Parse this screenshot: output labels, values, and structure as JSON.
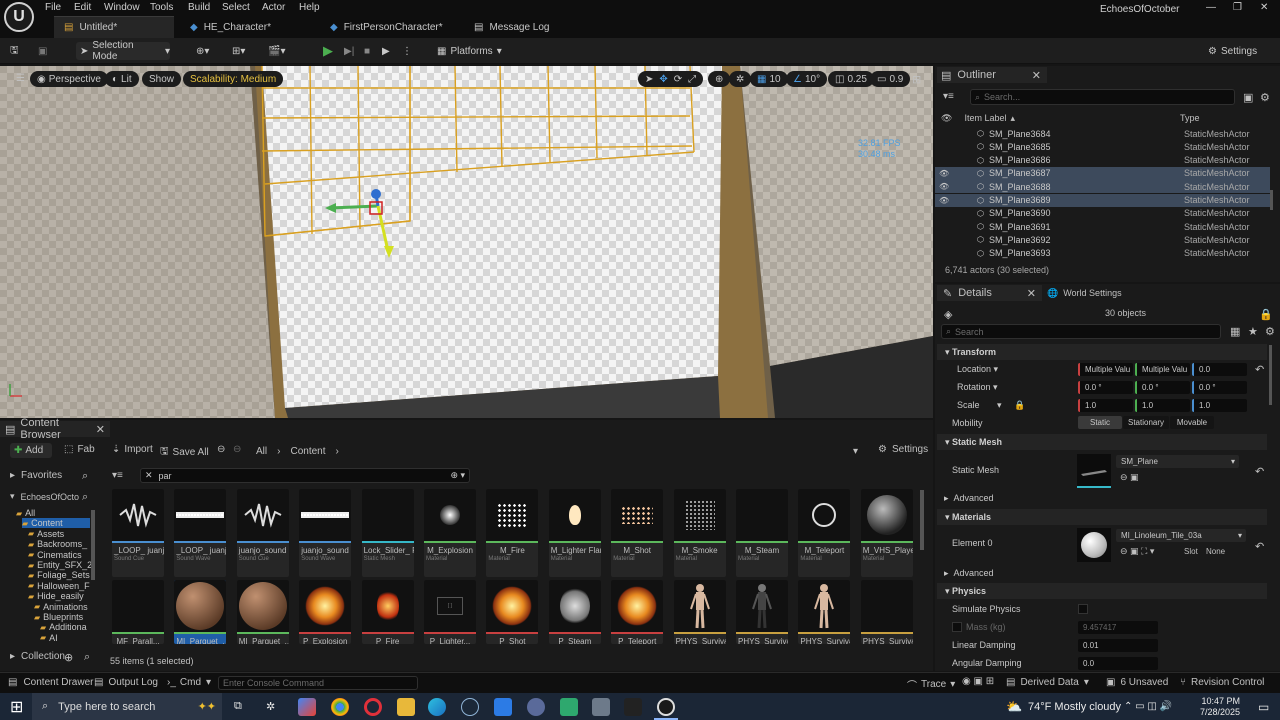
{
  "menu": {
    "logo": "U",
    "items": [
      "File",
      "Edit",
      "Window",
      "Tools",
      "Build",
      "Select",
      "Actor",
      "Help"
    ],
    "project_name": "EchoesOfOctober",
    "window_controls": [
      "—",
      "❐",
      "✕"
    ]
  },
  "tabs": [
    {
      "label": "Untitled*",
      "active": true
    },
    {
      "label": "HE_Character*",
      "active": false
    },
    {
      "label": "FirstPersonCharacter*",
      "active": false
    },
    {
      "label": "Message Log",
      "active": false
    }
  ],
  "toolbar": {
    "selection_mode": "Selection Mode",
    "platforms": "Platforms",
    "settings": "Settings"
  },
  "viewport": {
    "perspective": "Perspective",
    "lit": "Lit",
    "show": "Show",
    "scalability": "Scalability: Medium",
    "grid_snap": "10",
    "rot_snap": "10°",
    "scale_snap": "0.25",
    "cam_speed": "0.9",
    "fps": "32.81 FPS",
    "ms": "30.48 ms"
  },
  "outliner": {
    "title": "Outliner",
    "search_placeholder": "Search...",
    "col_label": "Item Label",
    "col_type": "Type",
    "rows": [
      {
        "label": "SM_Plane3684",
        "type": "StaticMeshActor",
        "selected": false
      },
      {
        "label": "SM_Plane3685",
        "type": "StaticMeshActor",
        "selected": false
      },
      {
        "label": "SM_Plane3686",
        "type": "StaticMeshActor",
        "selected": false
      },
      {
        "label": "SM_Plane3687",
        "type": "StaticMeshActor",
        "selected": true
      },
      {
        "label": "SM_Plane3688",
        "type": "StaticMeshActor",
        "selected": true
      },
      {
        "label": "SM_Plane3689",
        "type": "StaticMeshActor",
        "selected": true
      },
      {
        "label": "SM_Plane3690",
        "type": "StaticMeshActor",
        "selected": false
      },
      {
        "label": "SM_Plane3691",
        "type": "StaticMeshActor",
        "selected": false
      },
      {
        "label": "SM_Plane3692",
        "type": "StaticMeshActor",
        "selected": false
      },
      {
        "label": "SM_Plane3693",
        "type": "StaticMeshActor",
        "selected": false
      }
    ],
    "footer": "6,741 actors (30 selected)"
  },
  "details": {
    "title": "Details",
    "world_settings": "World Settings",
    "object_count": "30 objects",
    "search_placeholder": "Search",
    "transform": "Transform",
    "location": {
      "label": "Location",
      "x": "Multiple Valu",
      "y": "Multiple Valu",
      "z": "0.0"
    },
    "rotation": {
      "label": "Rotation",
      "x": "0.0 °",
      "y": "0.0 °",
      "z": "0.0 °"
    },
    "scale": {
      "label": "Scale",
      "x": "1.0",
      "y": "1.0",
      "z": "1.0"
    },
    "mobility": {
      "label": "Mobility",
      "options": [
        "Static",
        "Stationary",
        "Movable"
      ]
    },
    "static_mesh_section": "Static Mesh",
    "static_mesh_label": "Static Mesh",
    "static_mesh_value": "SM_Plane",
    "advanced": "Advanced",
    "materials_section": "Materials",
    "element0": "Element 0",
    "material_value": "MI_Linoleum_Tile_03a",
    "slot": "Slot",
    "slot_value": "None",
    "advanced2": "Advanced",
    "physics_section": "Physics",
    "simulate_physics": "Simulate Physics",
    "mass": "Mass (kg)",
    "mass_value": "9.457417",
    "linear_damping": "Linear Damping",
    "linear_damping_value": "0.01",
    "angular_damping": "Angular Damping",
    "angular_damping_value": "0.0"
  },
  "content_browser": {
    "title": "Content Browser",
    "add": "Add",
    "fab": "Fab",
    "import": "Import",
    "save_all": "Save All",
    "path": [
      "All",
      "Content"
    ],
    "settings": "Settings",
    "filter_text": "par",
    "favorites": "Favorites",
    "project": "EchoesOfOcto",
    "collection": "Collection",
    "tree": [
      "All",
      "Content",
      "Assets",
      "Backrooms_",
      "Cinematics",
      "Entity_SFX_2",
      "Foliage_Sets",
      "Halloween_F",
      "Hide_easily",
      "Animations",
      "Blueprints",
      "Additiona",
      "AI"
    ],
    "status": "55 items (1 selected)",
    "assets_row1": [
      {
        "name": "_LOOP_ juanjo_sou...",
        "type": "Sound Cue",
        "color": "#4a8fd0",
        "thumb": "wave"
      },
      {
        "name": "_LOOP_ juanjo_sou...",
        "type": "Sound Wave",
        "color": "#4a8fd0",
        "thumb": "wave2"
      },
      {
        "name": "juanjo_sound paradise...",
        "type": "Sound Cue",
        "color": "#4a8fd0",
        "thumb": "wave"
      },
      {
        "name": "juanjo_sound paradise...",
        "type": "Sound Wave",
        "color": "#4a8fd0",
        "thumb": "wave2"
      },
      {
        "name": "Lock_Slider_ Par_SM",
        "type": "Static Mesh",
        "color": "#36b8c8",
        "thumb": "dark"
      },
      {
        "name": "M_Explosion",
        "type": "Material",
        "color": "#5cb85c",
        "thumb": "glow"
      },
      {
        "name": "M_Fire",
        "type": "Material",
        "color": "#5cb85c",
        "thumb": "dots"
      },
      {
        "name": "M_Lighter Flame",
        "type": "Material",
        "color": "#5cb85c",
        "thumb": "flame"
      },
      {
        "name": "M_Shot",
        "type": "Material",
        "color": "#5cb85c",
        "thumb": "dots2"
      },
      {
        "name": "M_Smoke",
        "type": "Material",
        "color": "#5cb85c",
        "thumb": "grid"
      },
      {
        "name": "M_Steam",
        "type": "Material",
        "color": "#5cb85c",
        "thumb": "dark"
      },
      {
        "name": "M_Teleport",
        "type": "Material",
        "color": "#5cb85c",
        "thumb": "ring"
      },
      {
        "name": "M_VHS_Player Par",
        "type": "Material",
        "color": "#5cb85c",
        "thumb": "sphere"
      }
    ],
    "assets_row2": [
      {
        "name": "MF_Parall...",
        "color": "#5cb85c",
        "thumb": "dark"
      },
      {
        "name": "MI_Parquet_...",
        "color": "#5cb85c",
        "thumb": "wood",
        "selected": true
      },
      {
        "name": "MI_Parquet_...",
        "color": "#5cb85c",
        "thumb": "wood"
      },
      {
        "name": "P_Explosion",
        "color": "#c84040",
        "thumb": "burst"
      },
      {
        "name": "P_Fire",
        "color": "#c84040",
        "thumb": "fire"
      },
      {
        "name": "P_Lighter...",
        "color": "#c84040",
        "thumb": "noimg"
      },
      {
        "name": "P_Shot",
        "color": "#c84040",
        "thumb": "burst"
      },
      {
        "name": "P_Steam",
        "color": "#c84040",
        "thumb": "smoke"
      },
      {
        "name": "P_Teleport",
        "color": "#c84040",
        "thumb": "burst"
      },
      {
        "name": "PHYS_Survival...",
        "color": "#c8a040",
        "thumb": "man"
      },
      {
        "name": "PHYS_Survival...",
        "color": "#c8a040",
        "thumb": "man2"
      },
      {
        "name": "PHYS_Survival...",
        "color": "#c8a040",
        "thumb": "man"
      },
      {
        "name": "PHYS_Survival...",
        "color": "#c8a040",
        "thumb": "dark"
      }
    ]
  },
  "statusbar": {
    "content_drawer": "Content Drawer",
    "output_log": "Output Log",
    "cmd": "Cmd",
    "console_placeholder": "Enter Console Command",
    "trace": "Trace",
    "derived_data": "Derived Data",
    "unsaved": "6 Unsaved",
    "revision_control": "Revision Control"
  },
  "taskbar": {
    "search_placeholder": "Type here to search",
    "weather": "74°F  Mostly cloudy",
    "time": "10:47 PM",
    "date": "7/28/2025"
  }
}
